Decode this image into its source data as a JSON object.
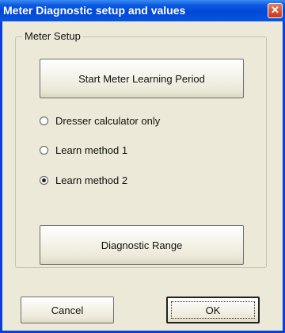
{
  "window": {
    "title": "Meter Diagnostic setup and values",
    "close_glyph": "✕"
  },
  "group": {
    "label": "Meter Setup"
  },
  "buttons": {
    "start_learning": "Start Meter Learning Period",
    "diagnostic_range": "Diagnostic Range",
    "cancel": "Cancel",
    "ok": "OK"
  },
  "options": [
    {
      "label": "Dresser calculator only",
      "checked": false
    },
    {
      "label": "Learn method 1",
      "checked": false
    },
    {
      "label": "Learn method 2",
      "checked": true
    }
  ],
  "colors": {
    "title_bar": "#0047d7",
    "dialog_bg": "#ece9d8"
  }
}
